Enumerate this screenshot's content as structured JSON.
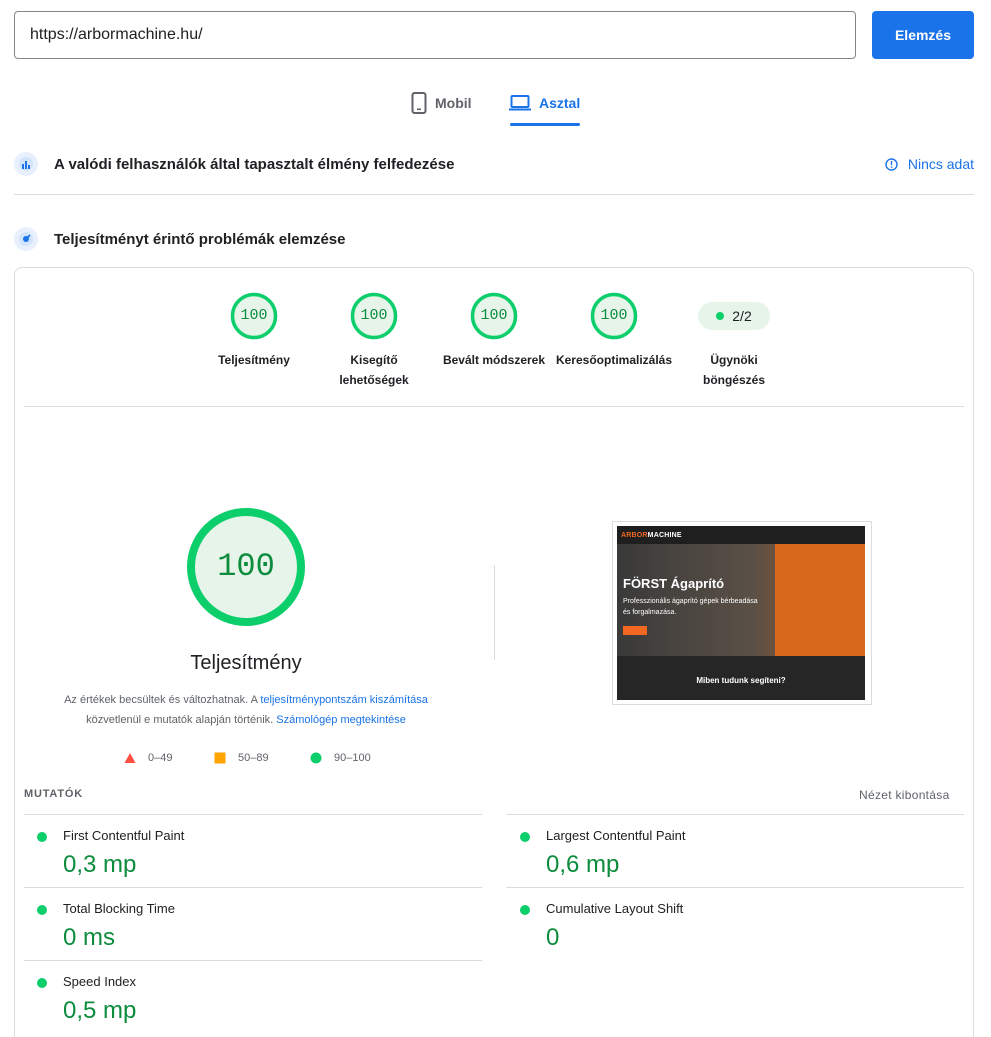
{
  "search": {
    "url": "https://arbormachine.hu/",
    "analyze_label": "Elemzés"
  },
  "tabs": [
    {
      "label": "Mobil",
      "icon": "mobile-phone-icon",
      "active": false
    },
    {
      "label": "Asztal",
      "icon": "laptop-icon",
      "active": true
    }
  ],
  "field_data": {
    "title": "A valódi felhasználók által tapasztalt élmény felfedezése",
    "status": "Nincs adat"
  },
  "lab": {
    "title": "Teljesítményt érintő problémák elemzése"
  },
  "categories": [
    {
      "score": "100",
      "label": "Teljesítmény"
    },
    {
      "score": "100",
      "label": "Kisegítő lehetőségek"
    },
    {
      "score": "100",
      "label": "Bevált módszerek"
    },
    {
      "score": "100",
      "label": "Keresőoptimalizálás"
    }
  ],
  "agent": {
    "badge": "2/2",
    "label": "Ügynöki böngészés"
  },
  "main": {
    "score": "100",
    "score_fraction": 1.0,
    "title": "Teljesítmény",
    "disclaimer_pre": "Az értékek becsültek és változhatnak. A ",
    "disclaimer_link1": "teljesítménypontszám kiszámítása",
    "disclaimer_mid": " közvetlenül e mutatók alapján történik. ",
    "disclaimer_link2": "Számológép megtekintése"
  },
  "legend": [
    {
      "label": "0–49",
      "color": "#ff4e42",
      "shape": "triangle"
    },
    {
      "label": "50–89",
      "color": "#ffa400",
      "shape": "square"
    },
    {
      "label": "90–100",
      "color": "#0cce6b",
      "shape": "circle"
    }
  ],
  "screenshot": {
    "logo_a": "ARBOR",
    "logo_b": "MACHINE",
    "heading": "FÖRST Ágaprító",
    "text": "Professzionális ágaprító gépek bérbeadása és forgalmazása.",
    "band": "Miben tudunk segíteni?"
  },
  "metrics": {
    "heading": "MUTATÓK",
    "expand": "Nézet kibontása",
    "items": [
      {
        "name": "First Contentful Paint",
        "value": "0,3 mp"
      },
      {
        "name": "Largest Contentful Paint",
        "value": "0,6 mp"
      },
      {
        "name": "Total Blocking Time",
        "value": "0 ms"
      },
      {
        "name": "Cumulative Layout Shift",
        "value": "0"
      },
      {
        "name": "Speed Index",
        "value": "0,5 mp"
      }
    ]
  },
  "colors": {
    "accent": "#1a73e8",
    "pass": "#0cce6b",
    "pass_text": "#0c8c3c",
    "pass_bg": "#e6f4ea"
  }
}
